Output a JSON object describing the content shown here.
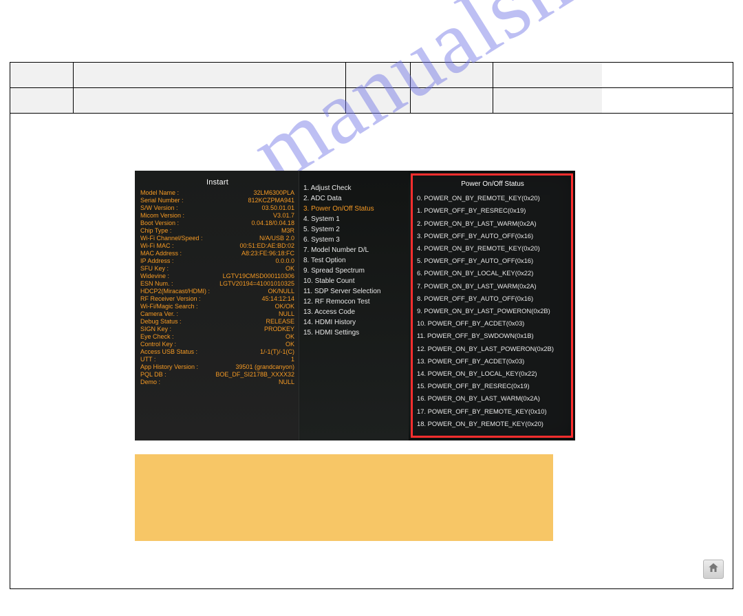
{
  "watermark": "manualsh  .  om",
  "shot": {
    "left_title": "Instart",
    "kv": [
      {
        "k": "Model Name :",
        "v": "32LM6300PLA"
      },
      {
        "k": "Serial Number :",
        "v": "812KCZPMA941"
      },
      {
        "k": "S/W Version :",
        "v": "03.50.01.01"
      },
      {
        "k": "Micom Version :",
        "v": "V3.01.7"
      },
      {
        "k": "Boot Version :",
        "v": "0.04.18/0.04.18"
      },
      {
        "k": "Chip Type :",
        "v": "M3R"
      },
      {
        "k": "Wi-Fi Channel/Speed :",
        "v": "N/A/USB 2.0"
      },
      {
        "k": "Wi-Fi MAC :",
        "v": "00:51:ED:AE:BD:02"
      },
      {
        "k": "MAC Address :",
        "v": "A8:23:FE:96:18:FC"
      },
      {
        "k": "IP Address :",
        "v": "0.0.0.0"
      },
      {
        "k": "SFU Key :",
        "v": "OK"
      },
      {
        "k": "Widevine :",
        "v": "LGTV19CMSD000110306"
      },
      {
        "k": "ESN Num. :",
        "v": "LGTV20194=41001010325"
      },
      {
        "k": "HDCP2(Miracast/HDMI) :",
        "v": "OK/NULL"
      },
      {
        "k": "RF Receiver Version :",
        "v": "45:14:12:14"
      },
      {
        "k": "Wi-Fi/Magic Search :",
        "v": "OK/OK"
      },
      {
        "k": "Camera Ver. :",
        "v": "NULL"
      },
      {
        "k": "Debug Status :",
        "v": "RELEASE"
      },
      {
        "k": "SIGN Key :",
        "v": "PRODKEY"
      },
      {
        "k": "Eye Check :",
        "v": "OK"
      },
      {
        "k": "Control Key :",
        "v": "OK"
      },
      {
        "k": "Access USB Status :",
        "v": "1/-1(T)/-1(C)"
      },
      {
        "k": "UTT :",
        "v": "1"
      },
      {
        "k": "App History Version :",
        "v": "39501 (grandcanyon)"
      },
      {
        "k": "PQL DB :",
        "v": "BOE_DF_SI2178B_XXXX32"
      },
      {
        "k": "Demo :",
        "v": "NULL"
      }
    ],
    "mid": [
      "1. Adjust Check",
      "2. ADC Data",
      "3. Power On/Off Status",
      "4. System 1",
      "5. System 2",
      "6. System 3",
      "7. Model Number D/L",
      "8. Test Option",
      "9. Spread Spectrum",
      "10. Stable Count",
      "11. SDP Server Selection",
      "12. RF Remocon Test",
      "13. Access Code",
      "14. HDMI History",
      "15. HDMI Settings"
    ],
    "mid_highlight_index": 2,
    "right_title": "Power On/Off Status",
    "right": [
      "0. POWER_ON_BY_REMOTE_KEY(0x20)",
      "1. POWER_OFF_BY_RESREC(0x19)",
      "2. POWER_ON_BY_LAST_WARM(0x2A)",
      "3. POWER_OFF_BY_AUTO_OFF(0x16)",
      "4. POWER_ON_BY_REMOTE_KEY(0x20)",
      "5. POWER_OFF_BY_AUTO_OFF(0x16)",
      "6. POWER_ON_BY_LOCAL_KEY(0x22)",
      "7. POWER_ON_BY_LAST_WARM(0x2A)",
      "8. POWER_OFF_BY_AUTO_OFF(0x16)",
      "9. POWER_ON_BY_LAST_POWERON(0x2B)",
      "10. POWER_OFF_BY_ACDET(0x03)",
      "11. POWER_OFF_BY_SWDOWN(0x1B)",
      "12. POWER_ON_BY_LAST_POWERON(0x2B)",
      "13. POWER_OFF_BY_ACDET(0x03)",
      "14. POWER_ON_BY_LOCAL_KEY(0x22)",
      "15. POWER_OFF_BY_RESREC(0x19)",
      "16. POWER_ON_BY_LAST_WARM(0x2A)",
      "17. POWER_OFF_BY_REMOTE_KEY(0x10)",
      "18. POWER_ON_BY_REMOTE_KEY(0x20)"
    ]
  }
}
